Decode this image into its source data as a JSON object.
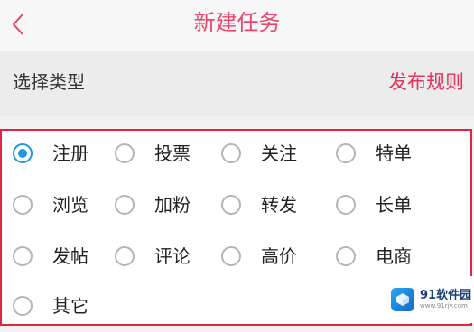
{
  "header": {
    "title": "新建任务",
    "back_icon": "chevron-left-icon"
  },
  "type_bar": {
    "label": "选择类型",
    "rules_link": "发布规则"
  },
  "options": [
    {
      "label": "注册",
      "selected": true
    },
    {
      "label": "投票",
      "selected": false
    },
    {
      "label": "关注",
      "selected": false
    },
    {
      "label": "特单",
      "selected": false
    },
    {
      "label": "浏览",
      "selected": false
    },
    {
      "label": "加粉",
      "selected": false
    },
    {
      "label": "转发",
      "selected": false
    },
    {
      "label": "长单",
      "selected": false
    },
    {
      "label": "发帖",
      "selected": false
    },
    {
      "label": "评论",
      "selected": false
    },
    {
      "label": "高价",
      "selected": false
    },
    {
      "label": "电商",
      "selected": false
    },
    {
      "label": "其它",
      "selected": false
    }
  ],
  "watermark": {
    "name": "91软件园",
    "url": "www.91rjy.com"
  },
  "colors": {
    "accent": "#e8456a",
    "border": "#e3243f",
    "radio_selected": "#1d9adf"
  }
}
